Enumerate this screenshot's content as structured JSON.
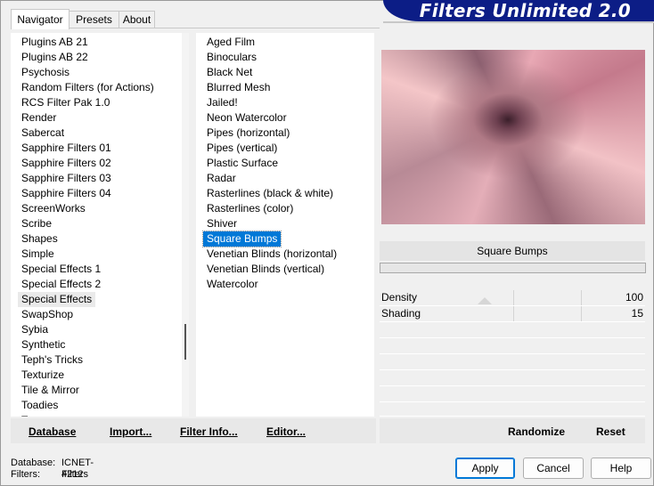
{
  "tabs": [
    {
      "label": "Navigator"
    },
    {
      "label": "Presets"
    },
    {
      "label": "About"
    }
  ],
  "banner_title": "Filters Unlimited 2.0",
  "categories": [
    "Plugins AB 21",
    "Plugins AB 22",
    "Psychosis",
    "Random Filters (for Actions)",
    "RCS Filter Pak 1.0",
    "Render",
    "Sabercat",
    "Sapphire Filters 01",
    "Sapphire Filters 02",
    "Sapphire Filters 03",
    "Sapphire Filters 04",
    "ScreenWorks",
    "Scribe",
    "Shapes",
    "Simple",
    "Special Effects 1",
    "Special Effects 2",
    "Special Effects",
    "SwapShop",
    "Sybia",
    "Synthetic",
    "Teph's Tricks",
    "Texturize",
    "Tile & Mirror",
    "Toadies",
    "Tr..."
  ],
  "selected_category": "Special Effects",
  "filters": [
    "Aged Film",
    "Binoculars",
    "Black Net",
    "Blurred Mesh",
    "Jailed!",
    "Neon Watercolor",
    "Pipes (horizontal)",
    "Pipes (vertical)",
    "Plastic Surface",
    "Radar",
    "Rasterlines (black & white)",
    "Rasterlines (color)",
    "Shiver",
    "Square Bumps",
    "Venetian Blinds (horizontal)",
    "Venetian Blinds (vertical)",
    "Watercolor"
  ],
  "selected_filter": "Square Bumps",
  "list_buttons": {
    "database": "Database",
    "import": "Import...",
    "filter_info": "Filter Info...",
    "editor": "Editor..."
  },
  "preview": {
    "filter_name": "Square Bumps"
  },
  "params": [
    {
      "label": "Density",
      "value": "100"
    },
    {
      "label": "Shading",
      "value": "15"
    }
  ],
  "preview_buttons": {
    "randomize": "Randomize",
    "reset": "Reset"
  },
  "footer": {
    "database_label": "Database:",
    "database_value": "ICNET-Filters",
    "filters_label": "Filters:",
    "filters_value": "4212"
  },
  "dialog_buttons": {
    "apply": "Apply",
    "cancel": "Cancel",
    "help": "Help"
  }
}
